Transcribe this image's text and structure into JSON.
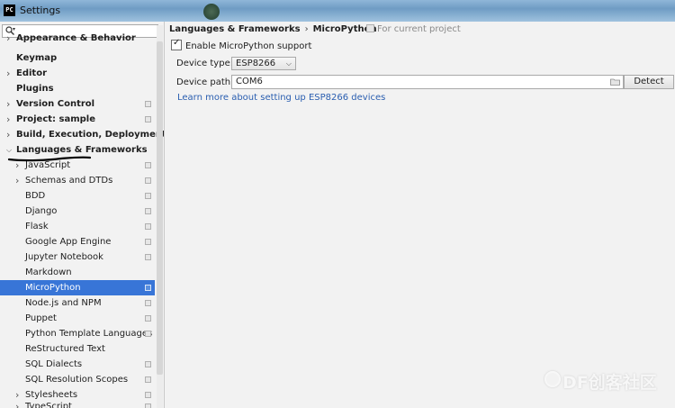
{
  "window": {
    "title": "Settings",
    "app_icon_text": "PC"
  },
  "sidebar": {
    "search": {
      "value": "",
      "placeholder": ""
    },
    "items": [
      {
        "label": "Appearance & Behavior",
        "level": 0,
        "arrow": true,
        "bold": true,
        "cut": true
      },
      {
        "label": "Keymap",
        "level": 0,
        "arrow": false,
        "bold": true
      },
      {
        "label": "Editor",
        "level": 0,
        "arrow": true,
        "bold": true
      },
      {
        "label": "Plugins",
        "level": 0,
        "arrow": false,
        "bold": true
      },
      {
        "label": "Version Control",
        "level": 0,
        "arrow": true,
        "bold": true,
        "proj": true
      },
      {
        "label": "Project: sample",
        "level": 0,
        "arrow": true,
        "bold": true,
        "proj": true
      },
      {
        "label": "Build, Execution, Deployment",
        "level": 0,
        "arrow": true,
        "bold": true
      },
      {
        "label": "Languages & Frameworks",
        "level": 0,
        "arrow": true,
        "open": true,
        "bold": true
      },
      {
        "label": "JavaScript",
        "level": 1,
        "arrow": true,
        "proj": true
      },
      {
        "label": "Schemas and DTDs",
        "level": 1,
        "arrow": true,
        "proj": true
      },
      {
        "label": "BDD",
        "level": 1,
        "proj": true
      },
      {
        "label": "Django",
        "level": 1,
        "proj": true
      },
      {
        "label": "Flask",
        "level": 1,
        "proj": true
      },
      {
        "label": "Google App Engine",
        "level": 1,
        "proj": true
      },
      {
        "label": "Jupyter Notebook",
        "level": 1,
        "proj": true
      },
      {
        "label": "Markdown",
        "level": 1
      },
      {
        "label": "MicroPython",
        "level": 1,
        "proj": true,
        "selected": true
      },
      {
        "label": "Node.js and NPM",
        "level": 1,
        "proj": true
      },
      {
        "label": "Puppet",
        "level": 1,
        "proj": true
      },
      {
        "label": "Python Template Languages",
        "level": 1,
        "proj": true
      },
      {
        "label": "ReStructured Text",
        "level": 1
      },
      {
        "label": "SQL Dialects",
        "level": 1,
        "proj": true
      },
      {
        "label": "SQL Resolution Scopes",
        "level": 1,
        "proj": true
      },
      {
        "label": "Stylesheets",
        "level": 1,
        "arrow": true,
        "proj": true
      },
      {
        "label": "TypeScript",
        "level": 1,
        "arrow": true,
        "proj": true,
        "cut": true
      }
    ]
  },
  "main": {
    "breadcrumb": {
      "parent": "Languages & Frameworks",
      "separator": "›",
      "current": "MicroPython"
    },
    "scope_note": "For current project",
    "enable_checkbox": {
      "label": "Enable MicroPython support",
      "checked": true
    },
    "device_type": {
      "label": "Device type:",
      "value": "ESP8266"
    },
    "device_path": {
      "label": "Device path:",
      "value": "COM6"
    },
    "detect_button": "Detect",
    "learn_link": "Learn more about setting up ESP8266 devices"
  },
  "watermark": {
    "text": "DF创客社区"
  },
  "colors": {
    "selection": "#3875d7",
    "link": "#2a5eb0",
    "annotation": "#000000"
  }
}
